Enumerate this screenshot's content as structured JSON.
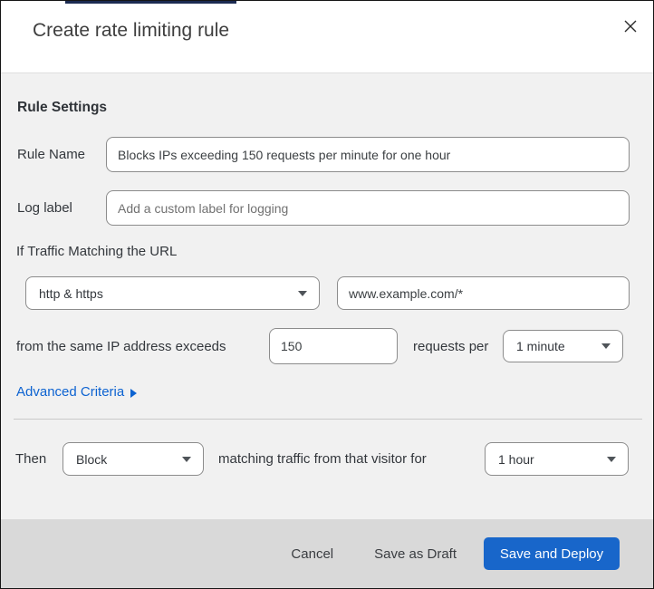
{
  "dialog": {
    "title": "Create rate limiting rule"
  },
  "rule_settings": {
    "heading": "Rule Settings",
    "rule_name_label": "Rule Name",
    "rule_name_value": "Blocks IPs exceeding 150 requests per minute for one hour",
    "log_label_label": "Log label",
    "log_label_placeholder": "Add a custom label for logging"
  },
  "match": {
    "heading": "If Traffic Matching the URL",
    "scheme_selected": "http & https",
    "url_value": "www.example.com/*",
    "threshold_prefix": "from the same IP address exceeds",
    "threshold_value": "150",
    "threshold_suffix": "requests per",
    "period_selected": "1 minute",
    "advanced_link": "Advanced Criteria"
  },
  "action": {
    "then_label": "Then",
    "action_selected": "Block",
    "middle_text": "matching traffic from that visitor for",
    "duration_selected": "1 hour"
  },
  "footer": {
    "cancel": "Cancel",
    "save_draft": "Save as Draft",
    "save_deploy": "Save and Deploy"
  },
  "colors": {
    "link_blue": "#0d63d1",
    "button_blue": "#1866ca",
    "navy_accent": "#1c2b52",
    "body_bg": "#f1f1f1",
    "footer_bg": "#d9d9d9",
    "input_border": "#8c8c8c"
  }
}
